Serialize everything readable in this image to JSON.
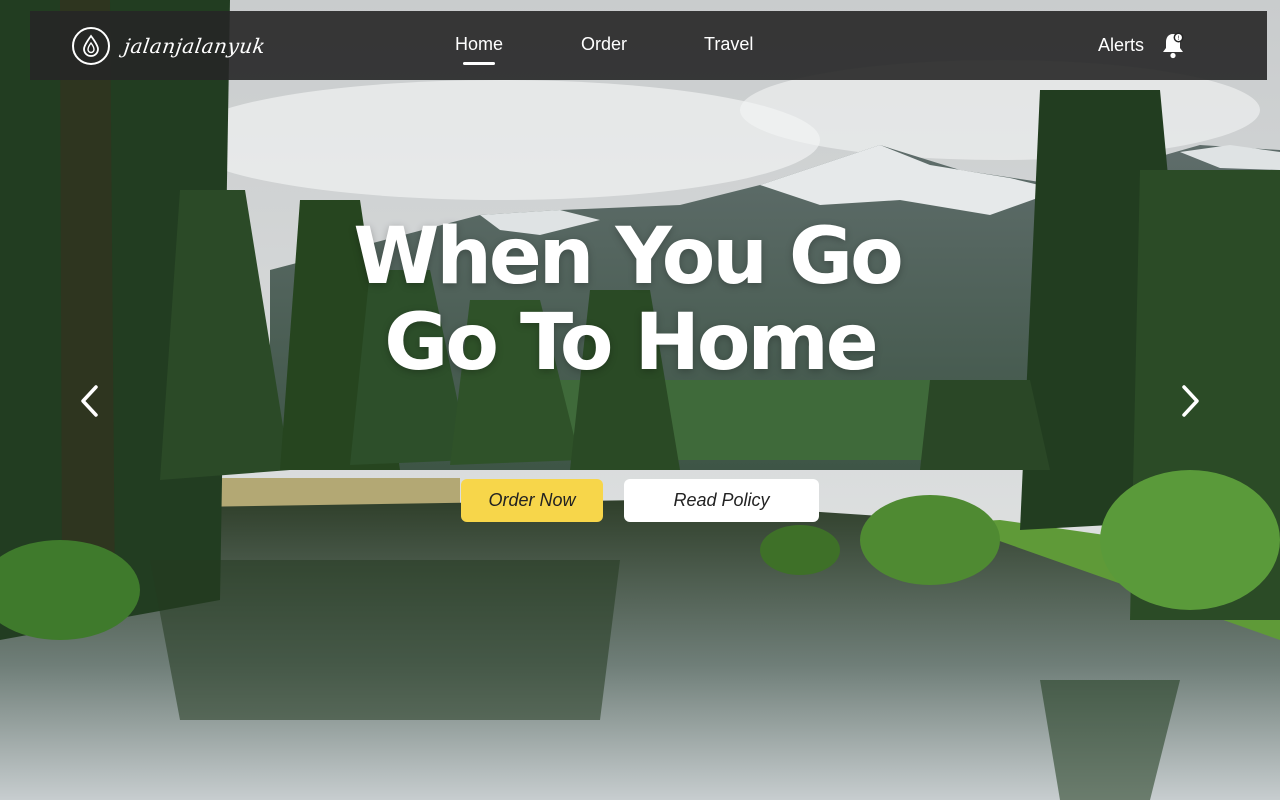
{
  "brand": {
    "name": "jalanjalanyuk",
    "logo_icon": "water-drop-icon"
  },
  "nav": {
    "items": [
      {
        "label": "Home",
        "active": true
      },
      {
        "label": "Order",
        "active": false
      },
      {
        "label": "Travel",
        "active": false
      }
    ]
  },
  "alerts": {
    "label": "Alerts",
    "icon": "bell-icon"
  },
  "hero": {
    "headline_line1": "When You Go",
    "headline_line2": "Go To Home",
    "primary_button": "Order Now",
    "secondary_button": "Read Policy",
    "prev_icon": "chevron-left-icon",
    "next_icon": "chevron-right-icon"
  },
  "colors": {
    "navbar_bg": "#262626",
    "primary_button": "#f7d64a",
    "secondary_button": "#ffffff",
    "text": "#ffffff"
  }
}
